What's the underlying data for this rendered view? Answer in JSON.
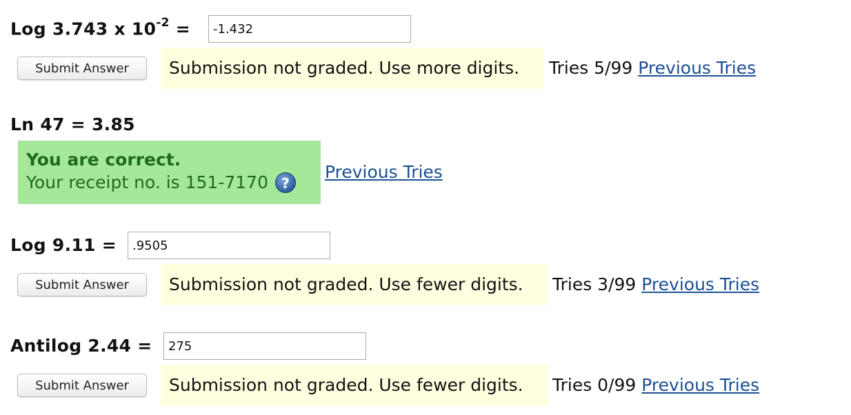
{
  "questions": [
    {
      "label_text": "Log 3.743 x 10",
      "label_sup": "-2",
      "label_suffix": " =",
      "input_value": "-1.432",
      "submit_label": "Submit Answer",
      "feedback": "Submission not graded. Use more digits.",
      "tries": "Tries 5/99",
      "previous_tries": "Previous Tries"
    },
    {
      "label_text": "Ln 47 = 3.85",
      "correct_title": "You are correct.",
      "receipt": "Your receipt no. is 151-7170",
      "help_icon": "?",
      "previous_tries": "Previous Tries"
    },
    {
      "label_text": "Log 9.11 =",
      "input_value": ".9505",
      "submit_label": "Submit Answer",
      "feedback": "Submission not graded. Use fewer digits.",
      "tries": "Tries 3/99",
      "previous_tries": "Previous Tries"
    },
    {
      "label_text": "Antilog 2.44 =",
      "input_value": "275",
      "submit_label": "Submit Answer",
      "feedback": "Submission not graded. Use fewer digits.",
      "tries": "Tries 0/99",
      "previous_tries": "Previous Tries"
    }
  ],
  "colors": {
    "feedback_bg": "#ffffe0",
    "correct_bg": "#a6e89a",
    "correct_text": "#1f6b1a",
    "link": "#1b4f93"
  }
}
